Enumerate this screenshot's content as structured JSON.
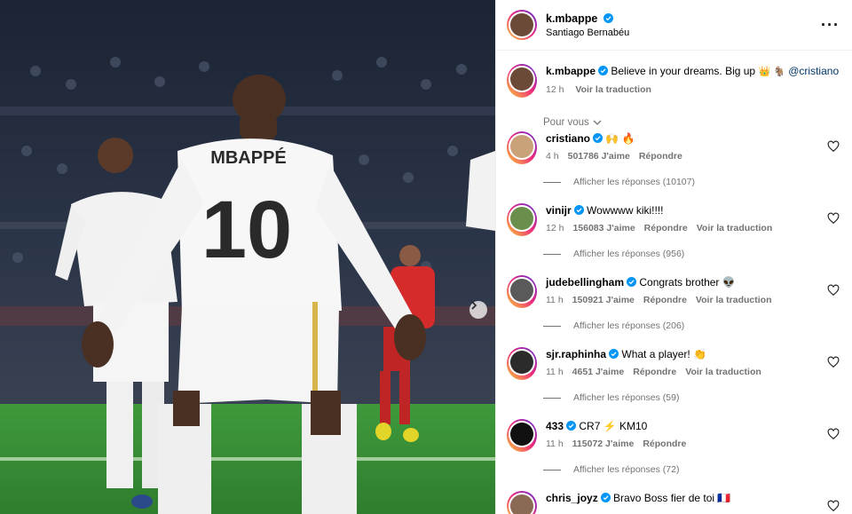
{
  "header": {
    "username": "k.mbappe",
    "location": "Santiago Bernabéu",
    "more_icon": "more-horizontal-icon"
  },
  "caption": {
    "username": "k.mbappe",
    "text": "Believe in your dreams. Big up",
    "emojis": "👑 🐐",
    "mention": "@cristiano",
    "time": "12 h",
    "translate": "Voir la traduction"
  },
  "pour_vous": "Pour vous",
  "comments": [
    {
      "username": "cristiano",
      "text": "🙌 🔥",
      "time": "4 h",
      "likes": "501786 J'aime",
      "reply": "Répondre",
      "translate": "",
      "replies": "Afficher les réponses (10107)",
      "avatar_color": "#c9a27a"
    },
    {
      "username": "vinijr",
      "text": "Wowwww kiki!!!!",
      "time": "12 h",
      "likes": "156083 J'aime",
      "reply": "Répondre",
      "translate": "Voir la traduction",
      "replies": "Afficher les réponses (956)",
      "avatar_color": "#6a8f4c"
    },
    {
      "username": "judebellingham",
      "text": "Congrats brother 👽",
      "time": "11 h",
      "likes": "150921 J'aime",
      "reply": "Répondre",
      "translate": "Voir la traduction",
      "replies": "Afficher les réponses (206)",
      "avatar_color": "#5a5a5a"
    },
    {
      "username": "sjr.raphinha",
      "text": "What a player! 👏",
      "time": "11 h",
      "likes": "4651 J'aime",
      "reply": "Répondre",
      "translate": "Voir la traduction",
      "replies": "Afficher les réponses (59)",
      "avatar_color": "#2b2b2b"
    },
    {
      "username": "433",
      "text": "CR7 ⚡ KM10",
      "time": "11 h",
      "likes": "115072 J'aime",
      "reply": "Répondre",
      "translate": "",
      "replies": "Afficher les réponses (72)",
      "avatar_color": "#111111"
    },
    {
      "username": "chris_joyz",
      "text": "Bravo Boss fier de toi 🇫🇷",
      "time": "",
      "likes": "",
      "reply": "",
      "translate": "",
      "replies": "",
      "avatar_color": "#8a6a55"
    }
  ],
  "photo": {
    "jersey_name": "MBAPPÉ",
    "jersey_number": "10",
    "next_icon": "chevron-right-icon"
  },
  "colors": {
    "verified": "#0095f6",
    "muted": "#737373",
    "mention": "#00376b"
  }
}
